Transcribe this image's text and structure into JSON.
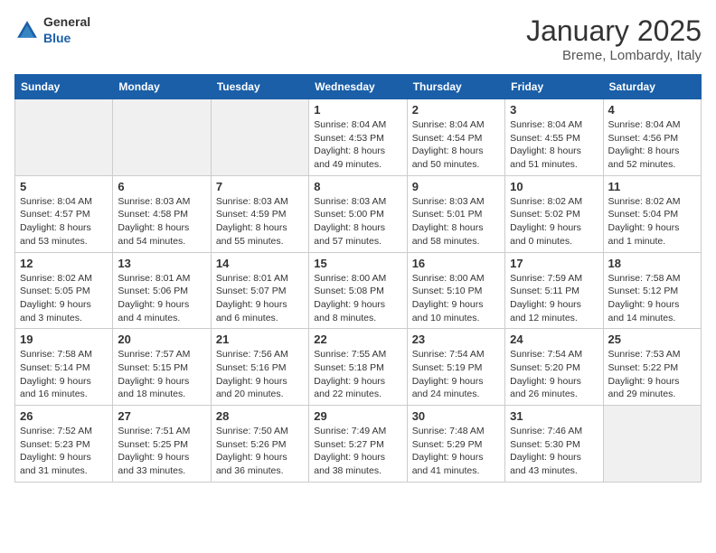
{
  "header": {
    "logo_general": "General",
    "logo_blue": "Blue",
    "month": "January 2025",
    "location": "Breme, Lombardy, Italy"
  },
  "weekdays": [
    "Sunday",
    "Monday",
    "Tuesday",
    "Wednesday",
    "Thursday",
    "Friday",
    "Saturday"
  ],
  "weeks": [
    [
      {
        "day": "",
        "text": "",
        "empty": true
      },
      {
        "day": "",
        "text": "",
        "empty": true
      },
      {
        "day": "",
        "text": "",
        "empty": true
      },
      {
        "day": "1",
        "text": "Sunrise: 8:04 AM\nSunset: 4:53 PM\nDaylight: 8 hours\nand 49 minutes."
      },
      {
        "day": "2",
        "text": "Sunrise: 8:04 AM\nSunset: 4:54 PM\nDaylight: 8 hours\nand 50 minutes."
      },
      {
        "day": "3",
        "text": "Sunrise: 8:04 AM\nSunset: 4:55 PM\nDaylight: 8 hours\nand 51 minutes."
      },
      {
        "day": "4",
        "text": "Sunrise: 8:04 AM\nSunset: 4:56 PM\nDaylight: 8 hours\nand 52 minutes."
      }
    ],
    [
      {
        "day": "5",
        "text": "Sunrise: 8:04 AM\nSunset: 4:57 PM\nDaylight: 8 hours\nand 53 minutes."
      },
      {
        "day": "6",
        "text": "Sunrise: 8:03 AM\nSunset: 4:58 PM\nDaylight: 8 hours\nand 54 minutes."
      },
      {
        "day": "7",
        "text": "Sunrise: 8:03 AM\nSunset: 4:59 PM\nDaylight: 8 hours\nand 55 minutes."
      },
      {
        "day": "8",
        "text": "Sunrise: 8:03 AM\nSunset: 5:00 PM\nDaylight: 8 hours\nand 57 minutes."
      },
      {
        "day": "9",
        "text": "Sunrise: 8:03 AM\nSunset: 5:01 PM\nDaylight: 8 hours\nand 58 minutes."
      },
      {
        "day": "10",
        "text": "Sunrise: 8:02 AM\nSunset: 5:02 PM\nDaylight: 9 hours\nand 0 minutes."
      },
      {
        "day": "11",
        "text": "Sunrise: 8:02 AM\nSunset: 5:04 PM\nDaylight: 9 hours\nand 1 minute."
      }
    ],
    [
      {
        "day": "12",
        "text": "Sunrise: 8:02 AM\nSunset: 5:05 PM\nDaylight: 9 hours\nand 3 minutes."
      },
      {
        "day": "13",
        "text": "Sunrise: 8:01 AM\nSunset: 5:06 PM\nDaylight: 9 hours\nand 4 minutes."
      },
      {
        "day": "14",
        "text": "Sunrise: 8:01 AM\nSunset: 5:07 PM\nDaylight: 9 hours\nand 6 minutes."
      },
      {
        "day": "15",
        "text": "Sunrise: 8:00 AM\nSunset: 5:08 PM\nDaylight: 9 hours\nand 8 minutes."
      },
      {
        "day": "16",
        "text": "Sunrise: 8:00 AM\nSunset: 5:10 PM\nDaylight: 9 hours\nand 10 minutes."
      },
      {
        "day": "17",
        "text": "Sunrise: 7:59 AM\nSunset: 5:11 PM\nDaylight: 9 hours\nand 12 minutes."
      },
      {
        "day": "18",
        "text": "Sunrise: 7:58 AM\nSunset: 5:12 PM\nDaylight: 9 hours\nand 14 minutes."
      }
    ],
    [
      {
        "day": "19",
        "text": "Sunrise: 7:58 AM\nSunset: 5:14 PM\nDaylight: 9 hours\nand 16 minutes."
      },
      {
        "day": "20",
        "text": "Sunrise: 7:57 AM\nSunset: 5:15 PM\nDaylight: 9 hours\nand 18 minutes."
      },
      {
        "day": "21",
        "text": "Sunrise: 7:56 AM\nSunset: 5:16 PM\nDaylight: 9 hours\nand 20 minutes."
      },
      {
        "day": "22",
        "text": "Sunrise: 7:55 AM\nSunset: 5:18 PM\nDaylight: 9 hours\nand 22 minutes."
      },
      {
        "day": "23",
        "text": "Sunrise: 7:54 AM\nSunset: 5:19 PM\nDaylight: 9 hours\nand 24 minutes."
      },
      {
        "day": "24",
        "text": "Sunrise: 7:54 AM\nSunset: 5:20 PM\nDaylight: 9 hours\nand 26 minutes."
      },
      {
        "day": "25",
        "text": "Sunrise: 7:53 AM\nSunset: 5:22 PM\nDaylight: 9 hours\nand 29 minutes."
      }
    ],
    [
      {
        "day": "26",
        "text": "Sunrise: 7:52 AM\nSunset: 5:23 PM\nDaylight: 9 hours\nand 31 minutes."
      },
      {
        "day": "27",
        "text": "Sunrise: 7:51 AM\nSunset: 5:25 PM\nDaylight: 9 hours\nand 33 minutes."
      },
      {
        "day": "28",
        "text": "Sunrise: 7:50 AM\nSunset: 5:26 PM\nDaylight: 9 hours\nand 36 minutes."
      },
      {
        "day": "29",
        "text": "Sunrise: 7:49 AM\nSunset: 5:27 PM\nDaylight: 9 hours\nand 38 minutes."
      },
      {
        "day": "30",
        "text": "Sunrise: 7:48 AM\nSunset: 5:29 PM\nDaylight: 9 hours\nand 41 minutes."
      },
      {
        "day": "31",
        "text": "Sunrise: 7:46 AM\nSunset: 5:30 PM\nDaylight: 9 hours\nand 43 minutes."
      },
      {
        "day": "",
        "text": "",
        "empty": true
      }
    ]
  ]
}
